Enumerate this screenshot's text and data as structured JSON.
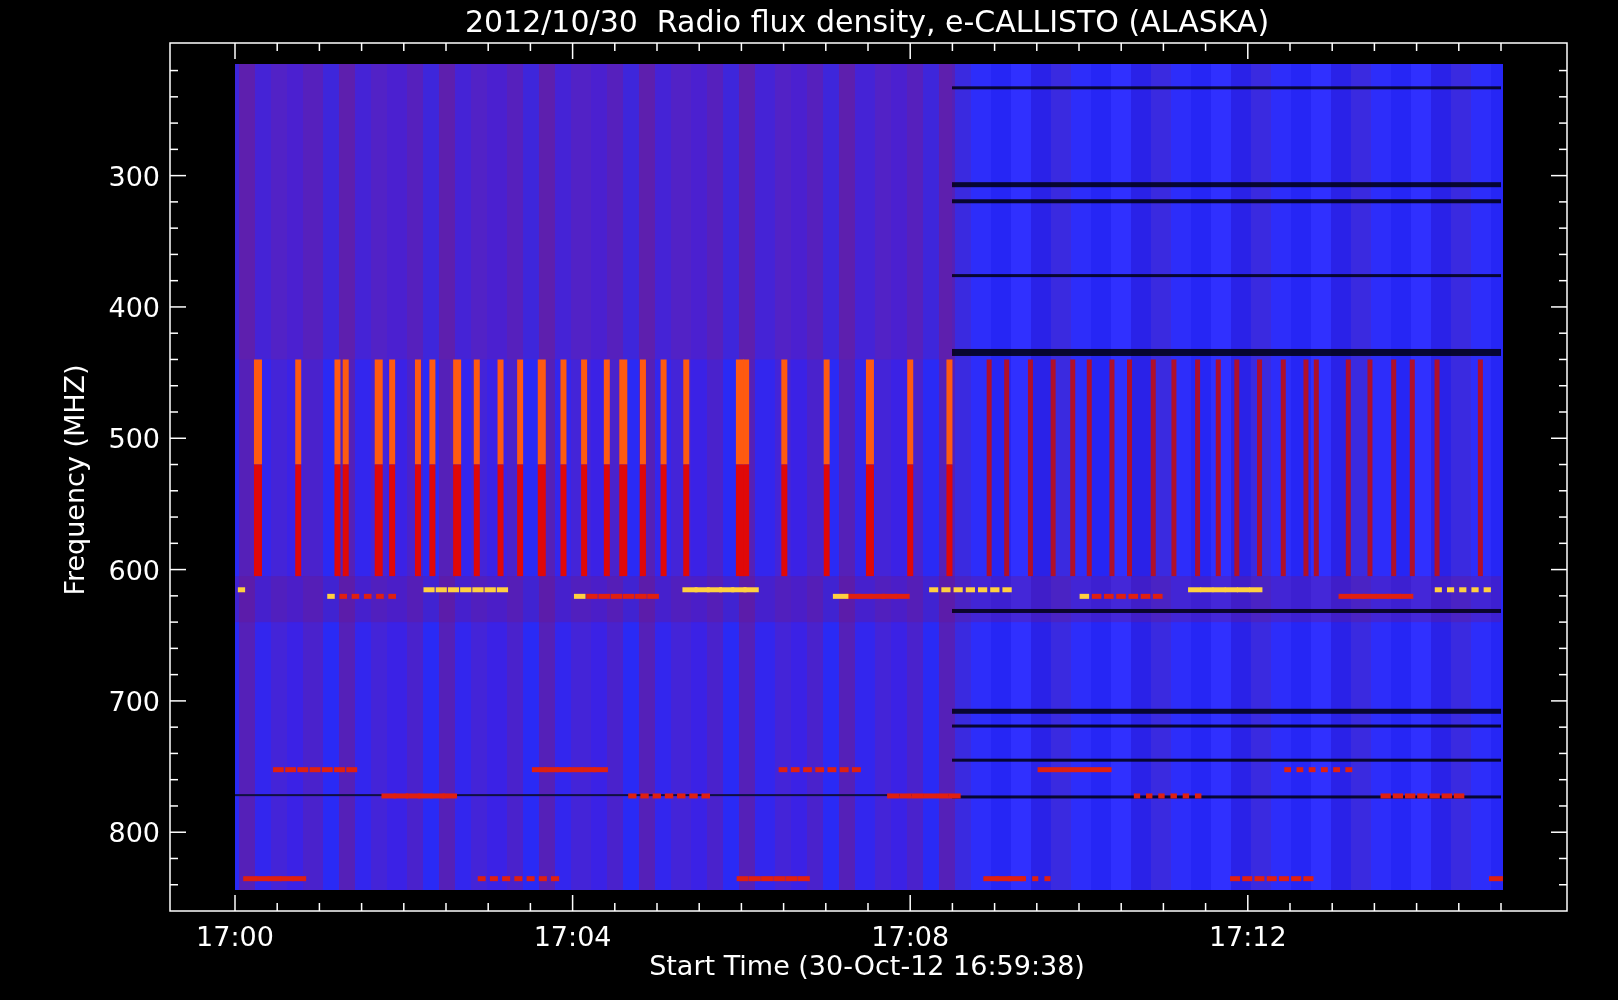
{
  "title": "2012/10/30  Radio flux density, e-CALLISTO (ALASKA)",
  "ylabel": "Frequency (MHZ)",
  "xlabel": "Start Time (30-Oct-12 16:59:38)",
  "yticks": [
    "300",
    "400",
    "500",
    "600",
    "700",
    "800"
  ],
  "xticks": [
    "17:00",
    "17:04",
    "17:08",
    "17:12"
  ]
}
